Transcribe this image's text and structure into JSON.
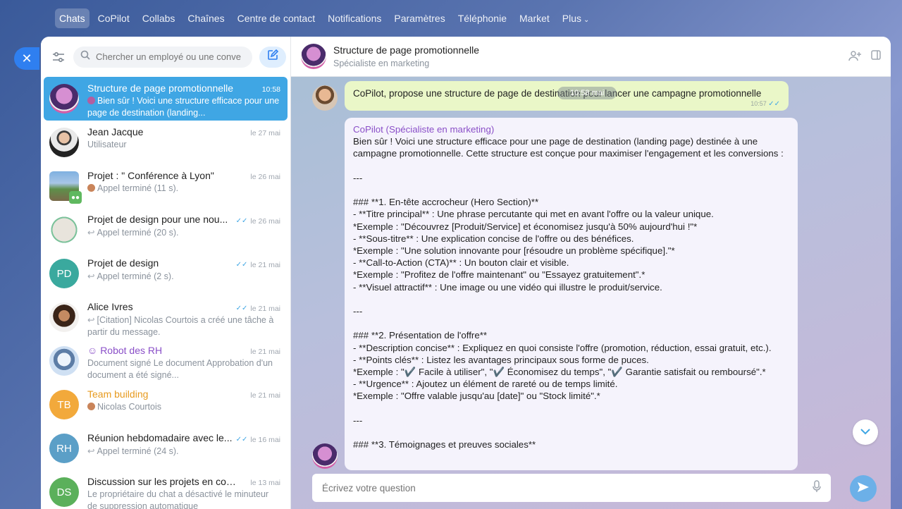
{
  "nav": {
    "items": [
      "Chats",
      "CoPilot",
      "Collabs",
      "Chaînes",
      "Centre de contact",
      "Notifications",
      "Paramètres",
      "Téléphonie",
      "Market",
      "Plus"
    ],
    "active": "Chats"
  },
  "sidebar": {
    "search_placeholder": "Chercher un employé ou une conve",
    "chats": [
      {
        "title": "Structure de page promotionnelle",
        "date": "10:58",
        "sub": "Bien sûr ! Voici une structure efficace pour une page de destination (landing...",
        "active": true
      },
      {
        "title": "Jean Jacque",
        "date": "le 27 mai",
        "sub": "Utilisateur"
      },
      {
        "title": "Projet : \" Conférence à Lyon\"",
        "date": "le 26 mai",
        "sub": "Appel terminé (11 s)."
      },
      {
        "title": "Projet de design pour une nou...",
        "date": "le 26 mai",
        "sub": "Appel terminé (20 s)."
      },
      {
        "title": "Projet de design",
        "date": "le 21 mai",
        "sub": "Appel terminé (2 s).",
        "initials": "PD"
      },
      {
        "title": "Alice Ivres",
        "date": "le 21 mai",
        "sub": "[Citation] Nicolas Courtois a créé une tâche à partir du message."
      },
      {
        "title": "Robot des RH",
        "date": "le 21 mai",
        "sub": "Document signé Le document Approbation d'un document a été signé..."
      },
      {
        "title": "Team building",
        "date": "le 21 mai",
        "sub": "Nicolas Courtois",
        "initials": "TB"
      },
      {
        "title": "Réunion hebdomadaire avec le...",
        "date": "le 16 mai",
        "sub": "Appel terminé (24 s).",
        "initials": "RH"
      },
      {
        "title": "Discussion sur les projets en cours",
        "date": "le 13 mai",
        "sub": "Le propriétaire du chat a désactivé le minuteur de suppression automatique",
        "initials": "DS"
      }
    ]
  },
  "header": {
    "title": "Structure de page promotionnelle",
    "subtitle": "Spécialiste en marketing"
  },
  "conversation": {
    "date_pill": "10:58 mai",
    "out_message": "CoPilot, propose une structure de page de destination pour lancer une campagne promotionnelle",
    "out_time": "10:57",
    "in_author": "CoPilot (Spécialiste en marketing)",
    "in_message": "Bien sûr ! Voici une structure efficace pour une page de destination (landing page) destinée à une campagne promotionnelle. Cette structure est conçue pour maximiser l'engagement et les conversions :\n\n---\n\n### **1. En-tête accrocheur (Hero Section)**\n- **Titre principal** : Une phrase percutante qui met en avant l'offre ou la valeur unique.\n*Exemple : \"Découvrez [Produit/Service] et économisez jusqu'à 50% aujourd'hui !\"*\n- **Sous-titre** : Une explication concise de l'offre ou des bénéfices.\n*Exemple : \"Une solution innovante pour [résoudre un problème spécifique].\"*\n- **Call-to-Action (CTA)** : Un bouton clair et visible.\n*Exemple : \"Profitez de l'offre maintenant\" ou \"Essayez gratuitement\".*\n- **Visuel attractif** : Une image ou une vidéo qui illustre le produit/service.\n\n---\n\n### **2. Présentation de l'offre**\n- **Description concise** : Expliquez en quoi consiste l'offre (promotion, réduction, essai gratuit, etc.).\n- **Points clés** : Listez les avantages principaux sous forme de puces.\n*Exemple : \"✔️ Facile à utiliser\", \"✔️ Économisez du temps\", \"✔️ Garantie satisfait ou remboursé\".*\n- **Urgence** : Ajoutez un élément de rareté ou de temps limité.\n*Exemple : \"Offre valable jusqu'au [date]\" ou \"Stock limité\".*\n\n---\n\n### **3. Témoignages et preuves sociales**"
  },
  "composer": {
    "placeholder": "Écrivez votre question"
  }
}
